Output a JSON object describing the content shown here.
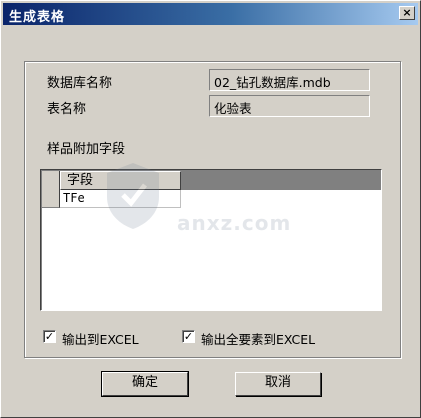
{
  "window": {
    "title": "生成表格",
    "close_glyph": "×"
  },
  "fields": {
    "db_label": "数据库名称",
    "db_value": "02_钻孔数据库.mdb",
    "table_label": "表名称",
    "table_value": "化验表"
  },
  "extra_fields_label": "样品附加字段",
  "grid": {
    "column_header": "字段",
    "rows": [
      "TFe"
    ]
  },
  "options": {
    "export_excel": {
      "label": "输出到EXCEL",
      "checked": true
    },
    "export_all_excel": {
      "label": "输出全要素到EXCEL",
      "checked": true
    }
  },
  "buttons": {
    "ok": "确定",
    "cancel": "取消"
  },
  "watermark": {
    "brand": "anxz.com",
    "icon": "shield-icon"
  }
}
